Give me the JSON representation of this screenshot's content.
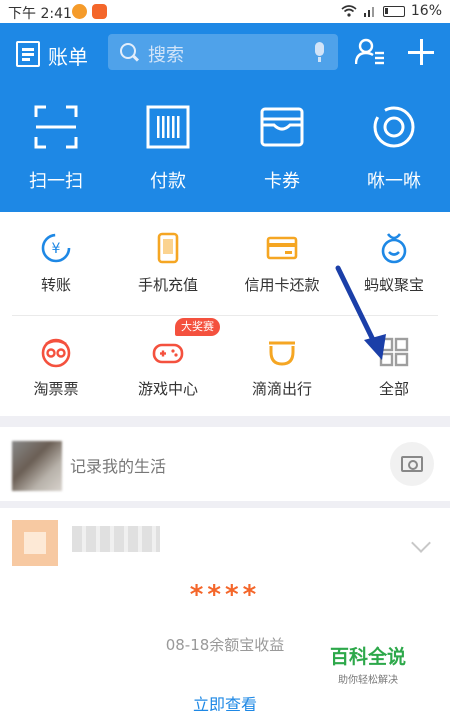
{
  "status_bar": {
    "time": "下午 2:41",
    "battery": "16%"
  },
  "header": {
    "bill_label": "账单",
    "search_placeholder": "搜索",
    "actions": [
      {
        "label": "扫一扫",
        "icon": "scan-icon"
      },
      {
        "label": "付款",
        "icon": "barcode-icon"
      },
      {
        "label": "卡券",
        "icon": "card-wallet-icon"
      },
      {
        "label": "咻一咻",
        "icon": "shake-icon"
      }
    ]
  },
  "grid": {
    "items": [
      {
        "label": "转账",
        "icon": "transfer-icon",
        "color": "#1e88e5"
      },
      {
        "label": "手机充值",
        "icon": "phone-topup-icon",
        "color": "#f5a623"
      },
      {
        "label": "信用卡还款",
        "icon": "credit-card-icon",
        "color": "#f5a623"
      },
      {
        "label": "蚂蚁聚宝",
        "icon": "ant-fortune-icon",
        "color": "#1e88e5"
      },
      {
        "label": "淘票票",
        "icon": "movie-ticket-icon",
        "color": "#f4513e"
      },
      {
        "label": "游戏中心",
        "icon": "gamepad-icon",
        "color": "#f4513e"
      },
      {
        "label": "滴滴出行",
        "icon": "didi-icon",
        "color": "#f5a623"
      },
      {
        "label": "全部",
        "icon": "grid-all-icon",
        "color": "#9e9e9e"
      }
    ],
    "badge": "大奖赛"
  },
  "life": {
    "label": "记录我的生活"
  },
  "card": {
    "amount": "****",
    "description": "08-18余额宝收益",
    "link": "立即查看"
  },
  "watermark": {
    "title": "百科全说",
    "subtitle": "助你轻松解决"
  },
  "colors": {
    "primary": "#1e88e5",
    "accent": "#f4662a",
    "annotation": "#1b3fa8"
  }
}
